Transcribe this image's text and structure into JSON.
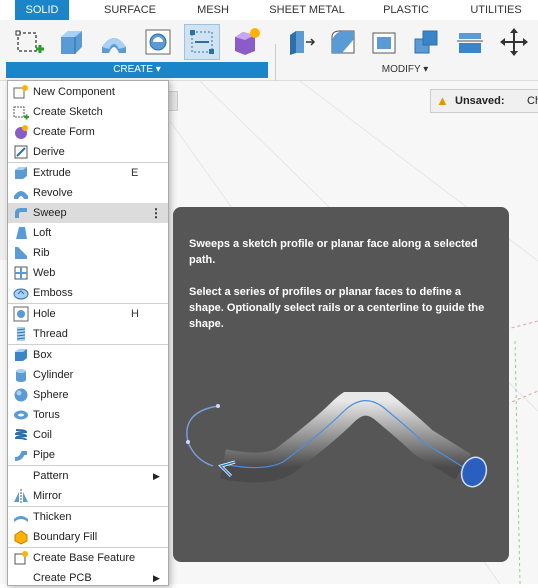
{
  "tabs": [
    "SOLID",
    "SURFACE",
    "MESH",
    "SHEET METAL",
    "PLASTIC",
    "UTILITIES"
  ],
  "ribbon": {
    "create_label": "CREATE ▾",
    "modify_label": "MODIFY ▾"
  },
  "status": {
    "unsaved_label": "Unsaved:",
    "trailing_text": "Ch"
  },
  "menu": {
    "items": [
      {
        "label": "New Component",
        "icon": "new-component-icon"
      },
      {
        "label": "Create Sketch",
        "icon": "create-sketch-icon"
      },
      {
        "label": "Create Form",
        "icon": "create-form-icon"
      },
      {
        "label": "Derive",
        "icon": "derive-icon"
      },
      {
        "label": "Extrude",
        "icon": "extrude-icon",
        "shortcut": "E"
      },
      {
        "label": "Revolve",
        "icon": "revolve-icon"
      },
      {
        "label": "Sweep",
        "icon": "sweep-icon",
        "more": "⋮"
      },
      {
        "label": "Loft",
        "icon": "loft-icon"
      },
      {
        "label": "Rib",
        "icon": "rib-icon"
      },
      {
        "label": "Web",
        "icon": "web-icon"
      },
      {
        "label": "Emboss",
        "icon": "emboss-icon"
      },
      {
        "label": "Hole",
        "icon": "hole-icon",
        "shortcut": "H"
      },
      {
        "label": "Thread",
        "icon": "thread-icon"
      },
      {
        "label": "Box",
        "icon": "box-icon"
      },
      {
        "label": "Cylinder",
        "icon": "cylinder-icon"
      },
      {
        "label": "Sphere",
        "icon": "sphere-icon"
      },
      {
        "label": "Torus",
        "icon": "torus-icon"
      },
      {
        "label": "Coil",
        "icon": "coil-icon"
      },
      {
        "label": "Pipe",
        "icon": "pipe-icon"
      },
      {
        "label": "Pattern",
        "icon": "pattern-icon",
        "submenu": "▶"
      },
      {
        "label": "Mirror",
        "icon": "mirror-icon"
      },
      {
        "label": "Thicken",
        "icon": "thicken-icon"
      },
      {
        "label": "Boundary Fill",
        "icon": "boundary-fill-icon"
      },
      {
        "label": "Create Base Feature",
        "icon": "base-feature-icon"
      },
      {
        "label": "Create PCB",
        "icon": "pcb-icon",
        "submenu": "▶"
      }
    ]
  },
  "tooltip": {
    "line1": "Sweeps a sketch profile or planar face along a selected path.",
    "line2": "Select a series of profiles or planar faces to define a shape. Optionally select rails or a centerline to guide the shape."
  },
  "colors": {
    "accent": "#1a85c8",
    "tooltip_bg": "#565656",
    "hover": "#dcdcdc"
  }
}
